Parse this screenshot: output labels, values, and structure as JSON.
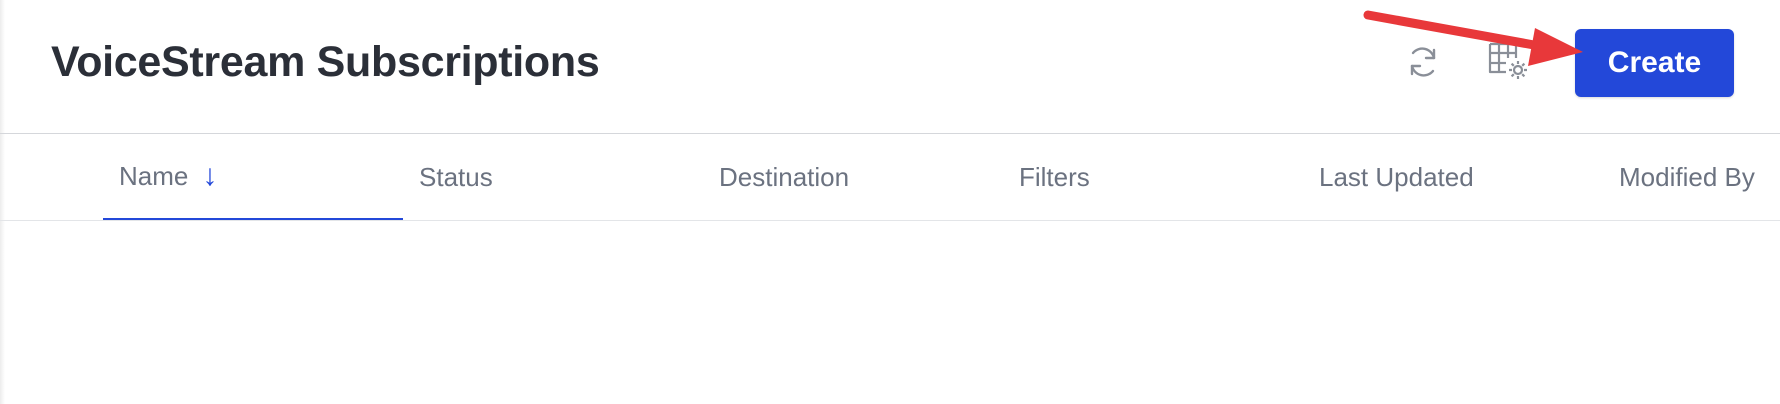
{
  "header": {
    "title": "VoiceStream Subscriptions",
    "refresh_icon": "refresh-icon",
    "grid_settings_icon": "grid-settings-icon",
    "create_label": "Create"
  },
  "table": {
    "columns": [
      {
        "label": "Name",
        "sorted": "descending",
        "sort_icon": "↓",
        "active": true
      },
      {
        "label": "Status"
      },
      {
        "label": "Destination"
      },
      {
        "label": "Filters"
      },
      {
        "label": "Last Updated"
      },
      {
        "label": "Modified By"
      }
    ],
    "rows": []
  },
  "colors": {
    "accent": "#2348d9",
    "title_text": "#2b2f38",
    "muted_text": "#6b7280",
    "annotation_arrow": "#e8383a"
  }
}
